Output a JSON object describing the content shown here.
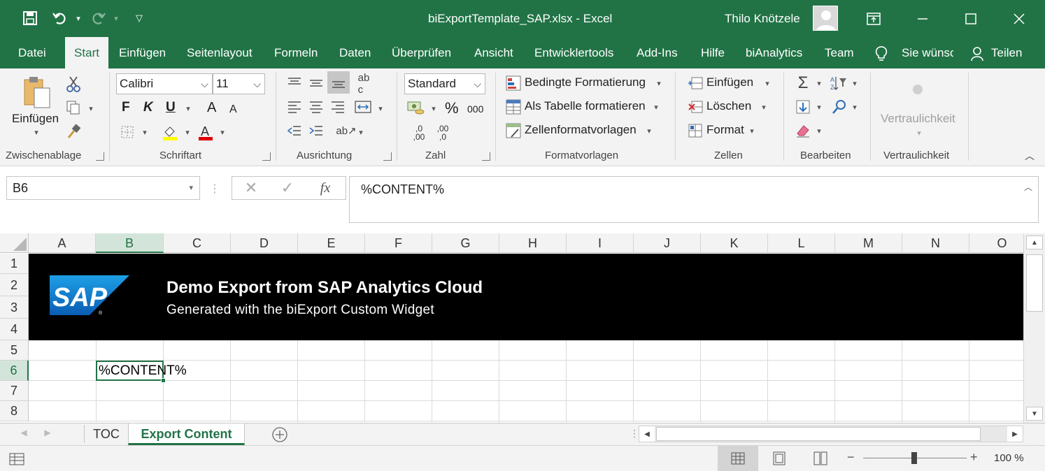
{
  "window": {
    "title": "biExportTemplate_SAP.xlsx  -  Excel",
    "user": "Thilo Knötzele"
  },
  "tabs": [
    {
      "label": "Datei"
    },
    {
      "label": "Start"
    },
    {
      "label": "Einfügen"
    },
    {
      "label": "Seitenlayout"
    },
    {
      "label": "Formeln"
    },
    {
      "label": "Daten"
    },
    {
      "label": "Überprüfen"
    },
    {
      "label": "Ansicht"
    },
    {
      "label": "Entwicklertools"
    },
    {
      "label": "Add-Ins"
    },
    {
      "label": "Hilfe"
    },
    {
      "label": "biAnalytics"
    },
    {
      "label": "Team"
    }
  ],
  "tellme": "Sie wünsc",
  "share": "Teilen",
  "ribbon": {
    "clipboard": {
      "paste": "Einfügen",
      "label": "Zwischenablage"
    },
    "font": {
      "name": "Calibri",
      "size": "11",
      "bold": "F",
      "italic": "K",
      "underline": "U",
      "grow": "A",
      "shrink": "A",
      "label": "Schriftart"
    },
    "alignment": {
      "label": "Ausrichtung"
    },
    "number": {
      "format": "Standard",
      "percent": "%",
      "thousands": "000",
      "inc": ",0",
      "inc2": ",00",
      "dec": ",00",
      "dec2": ",0",
      "label": "Zahl"
    },
    "styles": {
      "conditional": "Bedingte Formatierung",
      "table": "Als Tabelle formatieren",
      "cellstyles": "Zellenformatvorlagen",
      "label": "Formatvorlagen"
    },
    "cells": {
      "insert": "Einfügen",
      "delete": "Löschen",
      "format": "Format",
      "label": "Zellen"
    },
    "editing": {
      "label": "Bearbeiten"
    },
    "sensitivity": {
      "button": "Vertraulichkeit",
      "label": "Vertraulichkeit"
    }
  },
  "formula_bar": {
    "namebox": "B6",
    "fx": "fx",
    "formula": "%CONTENT%"
  },
  "columns": [
    "A",
    "B",
    "C",
    "D",
    "E",
    "F",
    "G",
    "H",
    "I",
    "J",
    "K",
    "L",
    "M",
    "N",
    "O"
  ],
  "rows": [
    "1",
    "2",
    "3",
    "4",
    "5",
    "6",
    "7",
    "8"
  ],
  "banner": {
    "logo": "SAP",
    "title": "Demo Export from SAP Analytics Cloud",
    "subtitle": "Generated with the biExport Custom Widget"
  },
  "cell_b6": "%CONTENT%",
  "sheets": [
    {
      "label": "TOC"
    },
    {
      "label": "Export Content"
    }
  ],
  "status": {
    "zoom": "100 %"
  },
  "colors": {
    "accent": "#217346",
    "banner": "#000000",
    "sap_blue": "#1170c4"
  }
}
